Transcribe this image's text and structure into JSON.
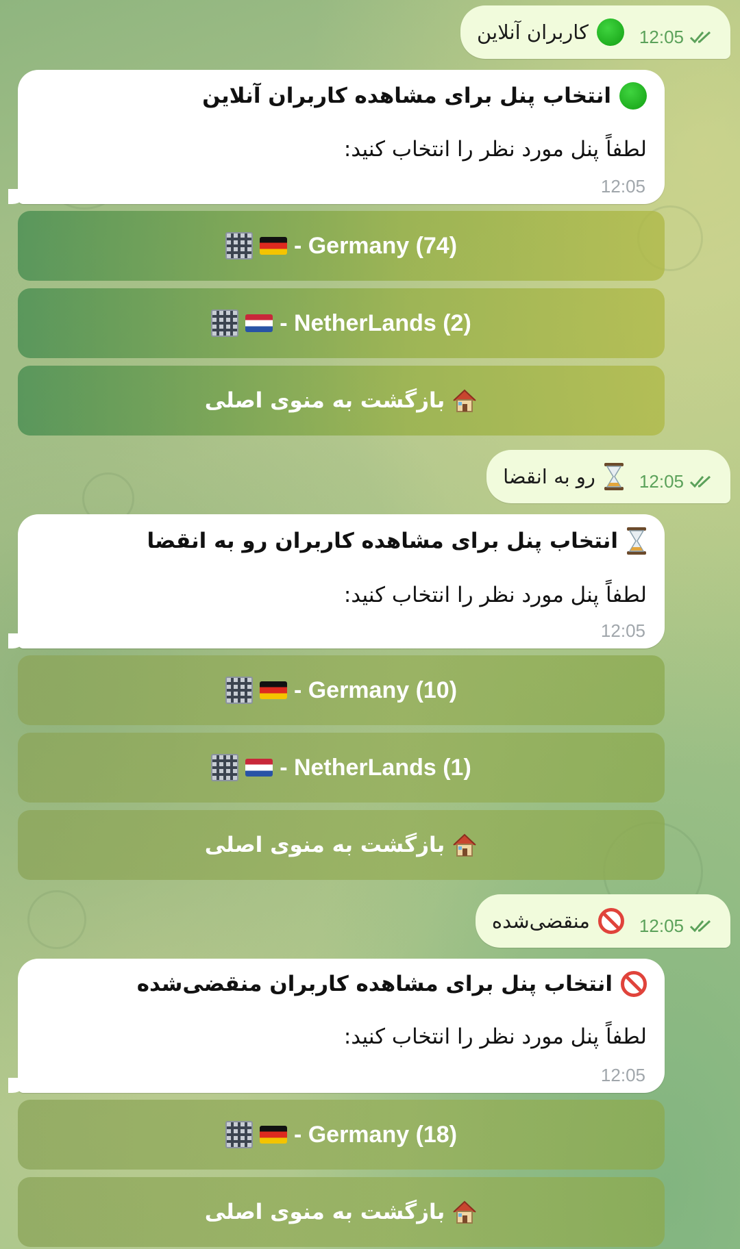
{
  "chat": {
    "groups": [
      {
        "request": {
          "text": "کاربران آنلاین",
          "time": "12:05",
          "status_icon": "double-check-icon",
          "emoji": "green-circle-icon"
        },
        "response": {
          "title": "انتخاب پنل برای مشاهده کاربران آنلاین",
          "title_emoji": "green-circle-icon",
          "body": "لطفاً پنل مورد نظر را انتخاب کنید:",
          "time": "12:05"
        },
        "buttons": [
          {
            "label": "- Germany (74)",
            "flag": "flag-germany",
            "icon": "building-icon"
          },
          {
            "label": "- NetherLands (2)",
            "flag": "flag-netherlands",
            "icon": "building-icon"
          }
        ],
        "back_button": "بازگشت به منوی اصلی"
      },
      {
        "request": {
          "text": "رو به انقضا",
          "time": "12:05",
          "status_icon": "double-check-icon",
          "emoji": "hourglass-icon"
        },
        "response": {
          "title": "انتخاب پنل برای مشاهده کاربران رو به انقضا",
          "title_emoji": "hourglass-icon",
          "body": "لطفاً پنل مورد نظر را انتخاب کنید:",
          "time": "12:05"
        },
        "buttons": [
          {
            "label": "- Germany (10)",
            "flag": "flag-germany",
            "icon": "building-icon"
          },
          {
            "label": "- NetherLands (1)",
            "flag": "flag-netherlands",
            "icon": "building-icon"
          }
        ],
        "back_button": "بازگشت به منوی اصلی"
      },
      {
        "request": {
          "text": "منقضی‌شده",
          "time": "12:05",
          "status_icon": "double-check-icon",
          "emoji": "forbidden-icon"
        },
        "response": {
          "title": "انتخاب پنل برای مشاهده کاربران منقضی‌شده",
          "title_emoji": "forbidden-icon",
          "body": "لطفاً پنل مورد نظر را انتخاب کنید:",
          "time": "12:05"
        },
        "buttons": [
          {
            "label": "- Germany (18)",
            "flag": "flag-germany",
            "icon": "building-icon"
          }
        ],
        "back_button": "بازگشت به منوی اصلی"
      }
    ]
  },
  "colors": {
    "outgoing_bubble": "#f1fbdc",
    "outgoing_time": "#5ba15a",
    "incoming_bubble": "#ffffff",
    "incoming_time": "#a0a6ab",
    "button_text": "#ffffff"
  }
}
